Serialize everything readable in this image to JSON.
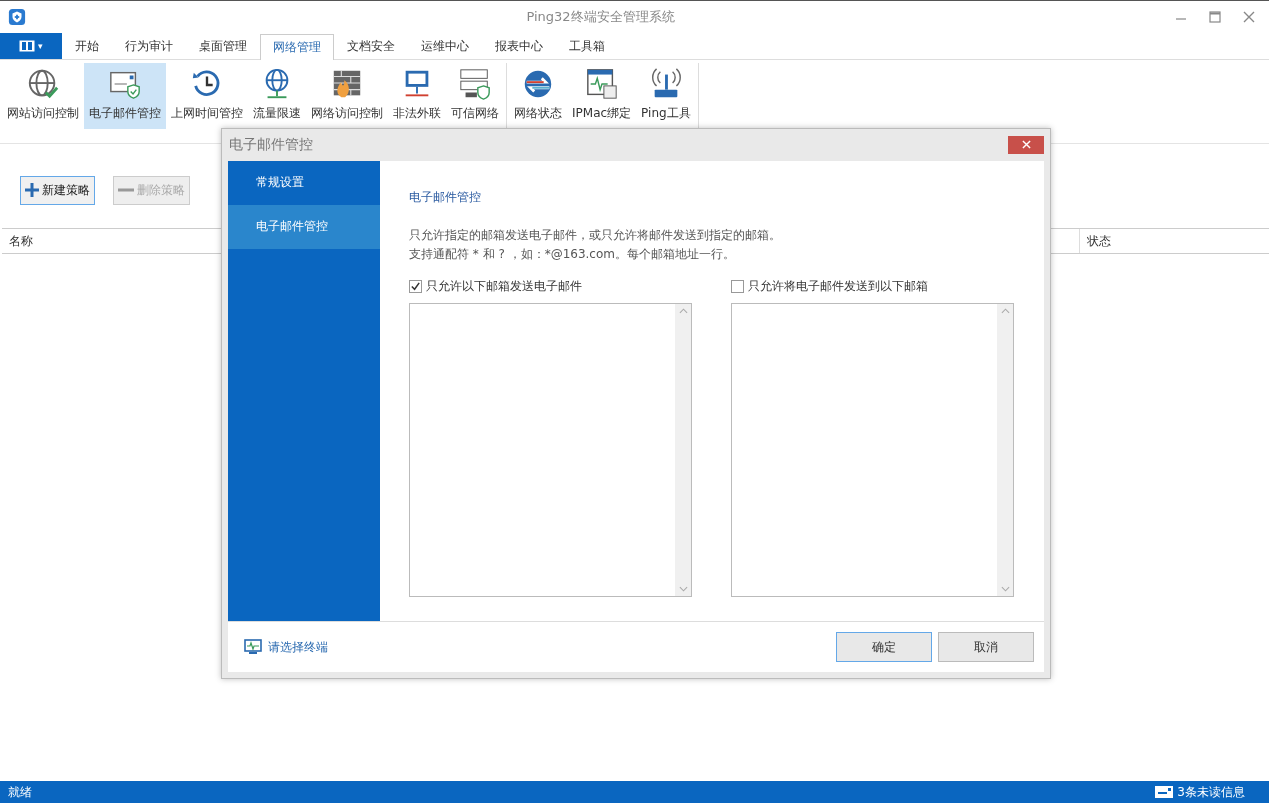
{
  "window": {
    "title": "Ping32终端安全管理系统"
  },
  "app_menu": {
    "label": "▾"
  },
  "tabs": [
    {
      "label": "开始",
      "selected": false
    },
    {
      "label": "行为审计",
      "selected": false
    },
    {
      "label": "桌面管理",
      "selected": false
    },
    {
      "label": "网络管理",
      "selected": true
    },
    {
      "label": "文档安全",
      "selected": false
    },
    {
      "label": "运维中心",
      "selected": false
    },
    {
      "label": "报表中心",
      "selected": false
    },
    {
      "label": "工具箱",
      "selected": false
    }
  ],
  "ribbon_groups": [
    {
      "items": [
        {
          "label": "网站访问控制",
          "selected": false
        },
        {
          "label": "电子邮件管控",
          "selected": true
        },
        {
          "label": "上网时间管控",
          "selected": false
        },
        {
          "label": "流量限速",
          "selected": false
        },
        {
          "label": "网络访问控制",
          "selected": false
        },
        {
          "label": "非法外联",
          "selected": false
        },
        {
          "label": "可信网络",
          "selected": false
        }
      ]
    },
    {
      "items": [
        {
          "label": "网络状态",
          "selected": false
        },
        {
          "label": "IPMac绑定",
          "selected": false
        },
        {
          "label": "Ping工具",
          "selected": false
        }
      ]
    }
  ],
  "toolbar": [
    {
      "label": "新建策略",
      "kind": "add",
      "disabled": false
    },
    {
      "label": "删除策略",
      "kind": "remove",
      "disabled": true
    }
  ],
  "table": {
    "columns": [
      "名称",
      "状态"
    ]
  },
  "dialog": {
    "title": "电子邮件管控",
    "sidebar": [
      {
        "label": "常规设置",
        "selected": false
      },
      {
        "label": "电子邮件管控",
        "selected": true
      }
    ],
    "heading": "电子邮件管控",
    "description": [
      "只允许指定的邮箱发送电子邮件，或只允许将邮件发送到指定的邮箱。",
      "支持通配符 * 和 ? ，如：*@163.com。每个邮箱地址一行。"
    ],
    "lists": [
      {
        "label": "只允许以下邮箱发送电子邮件",
        "checked": true
      },
      {
        "label": "只允许将电子邮件发送到以下邮箱",
        "checked": false
      }
    ],
    "terminal_link": "请选择终端",
    "buttons": [
      {
        "label": "确定",
        "default": true
      },
      {
        "label": "取消",
        "default": false
      }
    ]
  },
  "status_bar": {
    "status": "就绪",
    "messages": "3条未读信息"
  }
}
